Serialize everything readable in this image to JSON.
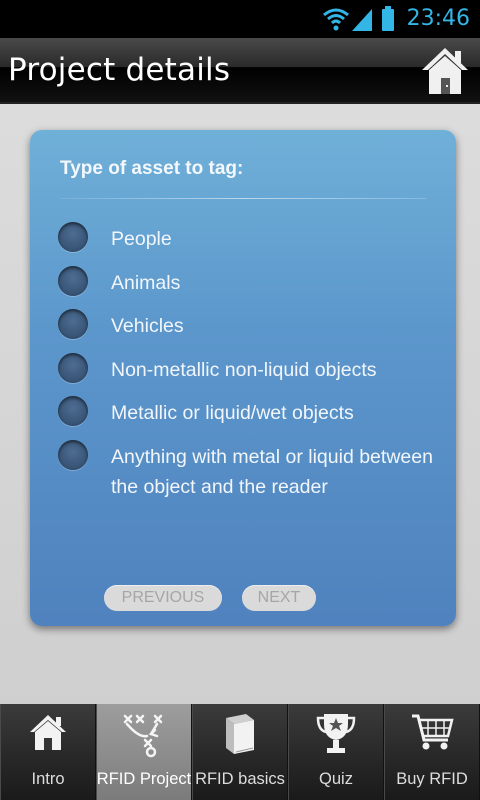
{
  "status_bar": {
    "time": "23:46",
    "icons": [
      "wifi-icon",
      "signal-icon",
      "battery-icon"
    ],
    "accent": "#33b5e5"
  },
  "header": {
    "title": "Project details",
    "home_icon": "home-icon"
  },
  "question": {
    "title": "Type of asset to tag:",
    "options": [
      {
        "label": "People",
        "selected": false
      },
      {
        "label": "Animals",
        "selected": false
      },
      {
        "label": "Vehicles",
        "selected": false
      },
      {
        "label": "Non-metallic non-liquid objects",
        "selected": false
      },
      {
        "label": "Metallic or liquid/wet objects",
        "selected": false
      },
      {
        "label": "Anything with metal or liquid between the object and the reader",
        "selected": false
      }
    ]
  },
  "nav": {
    "previous_label": "PREVIOUS",
    "next_label": "NEXT"
  },
  "tabs": [
    {
      "label": "Intro",
      "icon": "home-icon",
      "active": false
    },
    {
      "label": "RFID Project",
      "icon": "play-diagram-icon",
      "active": true
    },
    {
      "label": "RFID basics",
      "icon": "book-icon",
      "active": false
    },
    {
      "label": "Quiz",
      "icon": "trophy-icon",
      "active": false
    },
    {
      "label": "Buy RFID",
      "icon": "cart-icon",
      "active": false
    }
  ],
  "colors": {
    "card_top": "#6fb0d8",
    "card_bottom": "#4f82be",
    "header_bg": "#000000"
  }
}
